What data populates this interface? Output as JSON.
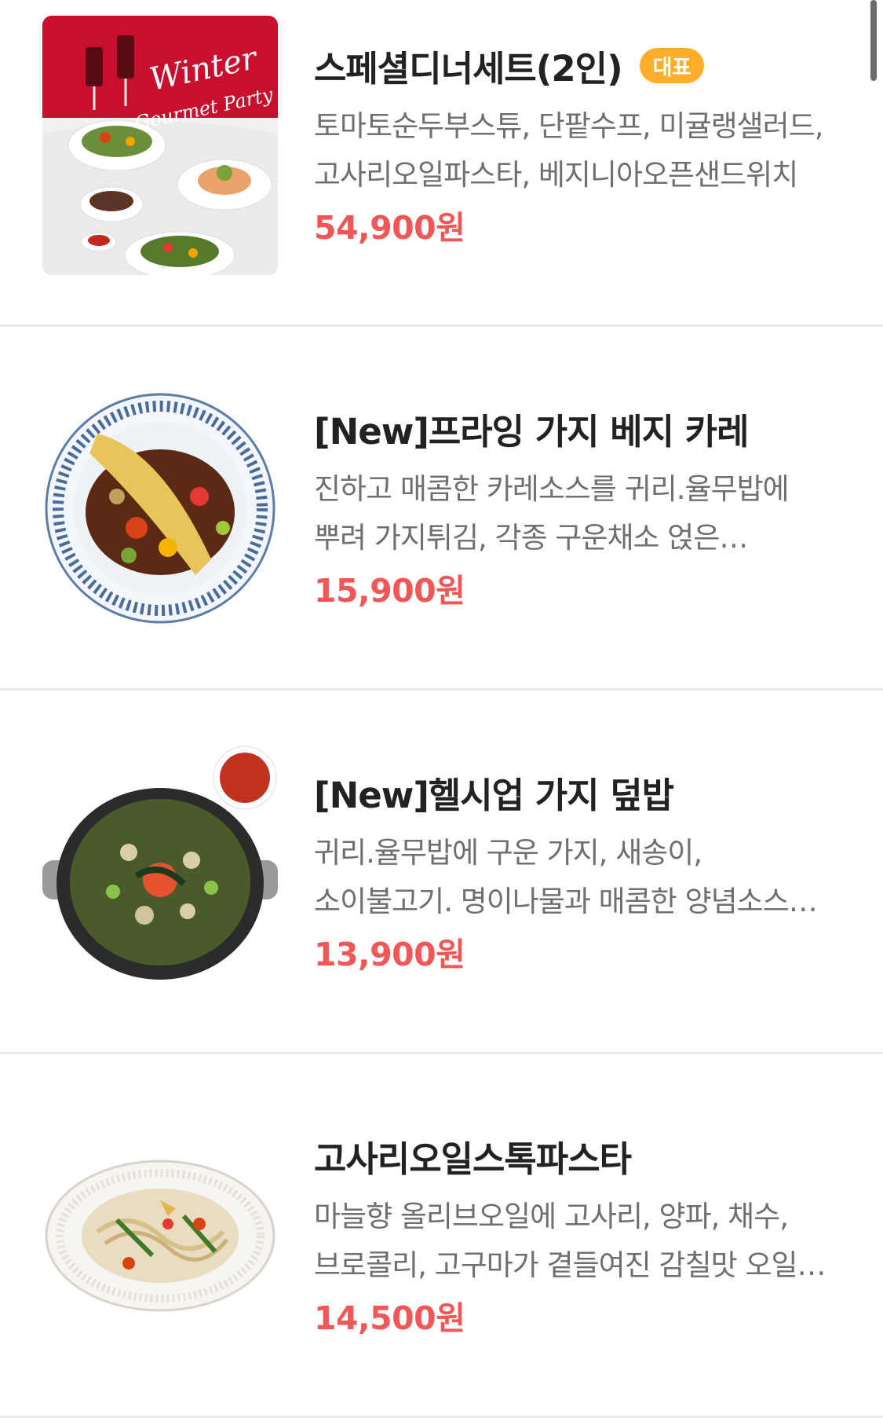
{
  "menu": {
    "items": [
      {
        "image_icon": "winter-gourmet-party-photo",
        "image_text": "Winter Gourmet Party",
        "title": "스페셜디너세트(2인)",
        "badge": "대표",
        "description": "토마토순두부스튜, 단팥수프, 미귤랭샐러드, 고사리오일파스타, 베지니아오픈샌드위치",
        "price": "54,900원"
      },
      {
        "image_icon": "eggplant-curry-plate-photo",
        "title": "[New]프라잉 가지 베지 카레",
        "description": "진하고 매콤한 카레소스를 귀리.율무밥에 뿌려 가지튀김, 각종 구운채소 얹은 카레라이스",
        "price": "15,900원"
      },
      {
        "image_icon": "eggplant-rice-bowl-photo",
        "title": "[New]헬시업 가지 덮밥",
        "description": "귀리.율무밥에 구운 가지, 새송이, 소이불고기. 명이나물과 매콤한 양념소스에 비벼",
        "price": "13,900원"
      },
      {
        "image_icon": "bracken-oil-pasta-photo",
        "title": "고사리오일스톡파스타",
        "description": "마늘향 올리브오일에 고사리, 양파, 채수,브로콜리, 고구마가 곁들여진 감칠맛 오일 파스타",
        "price": "14,500원"
      }
    ]
  },
  "colors": {
    "price": "#f25757",
    "badge": "#ffae2b",
    "title": "#222222",
    "description": "#6f6f6f",
    "divider": "#ececec"
  }
}
